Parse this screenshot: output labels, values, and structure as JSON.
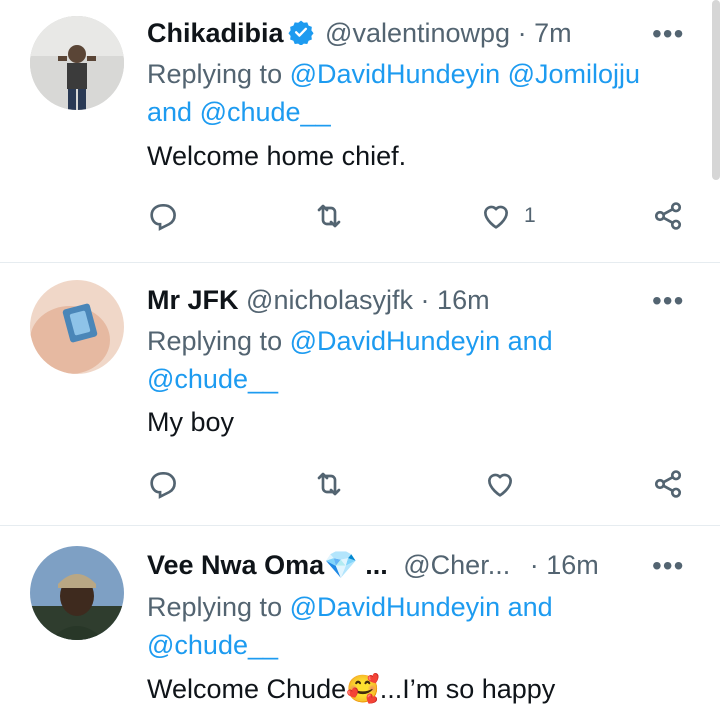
{
  "tweets": [
    {
      "name": "Chikadibia",
      "handle": "@valentinowpg",
      "dot": "·",
      "time": "7m",
      "verified": true,
      "replying_prefix": "Replying to",
      "mentions_line1": "@DavidHundeyin @Jomilojju",
      "and_word": "and",
      "mention_last": "@chude__",
      "text": "Welcome home chief.",
      "like_count": "1",
      "avatar_bg": "#cfcfcf"
    },
    {
      "name": "Mr JFK",
      "handle": "@nicholasyjfk",
      "dot": "·",
      "time": "16m",
      "replying_prefix": "Replying to",
      "mention_first": "@DavidHundeyin",
      "and_word": "and",
      "mention_last": "@chude__",
      "text": "My boy",
      "avatar_bg": "#e9c9b8"
    },
    {
      "name": "Vee Nwa Oma💎 ...",
      "handle": "@Cher...",
      "dot": "·",
      "time": "16m",
      "replying_prefix": "Replying to",
      "mention_first": "@DavidHundeyin",
      "and_word": "and",
      "mention_last": "@chude__",
      "text": "Welcome Chude🥰...I’m so happy",
      "avatar_bg": "#6d8fb0"
    }
  ],
  "more_label": "•••",
  "icons": [
    "reply-icon",
    "retweet-icon",
    "like-icon",
    "share-icon",
    "verified-badge-icon",
    "more-icon"
  ],
  "colors": {
    "link": "#1d9bf0",
    "secondary": "#536471",
    "primary": "#0f1419",
    "divider": "#e6ecf0"
  }
}
